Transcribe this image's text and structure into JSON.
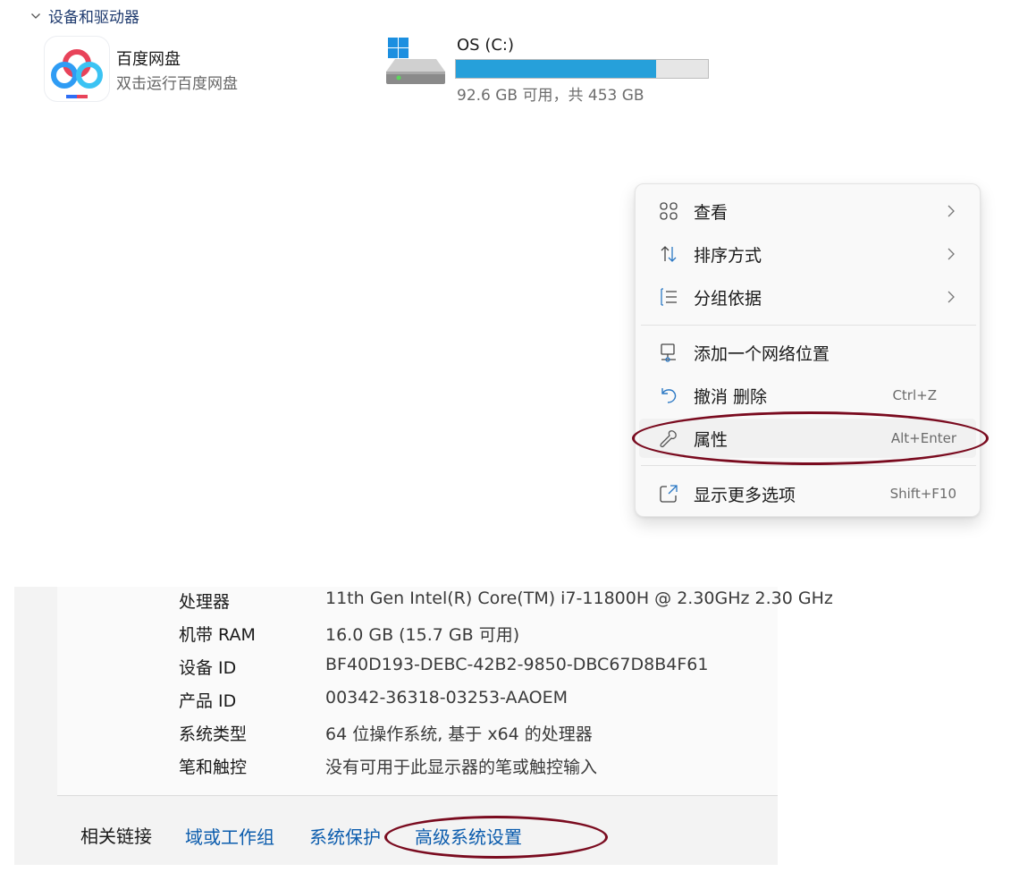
{
  "section": {
    "title": "设备和驱动器"
  },
  "app": {
    "name": "百度网盘",
    "subtitle": "双击运行百度网盘",
    "icon": "baidu-netdisk-icon"
  },
  "drive": {
    "name": "OS (C:)",
    "info": "92.6 GB 可用，共 453 GB",
    "used_fraction": 0.796,
    "icon": "drive-icon",
    "bar_color": "#26a0da"
  },
  "context_menu": {
    "items": [
      {
        "label": "查看",
        "icon": "view-grid-icon",
        "submenu": true
      },
      {
        "label": "排序方式",
        "icon": "sort-icon",
        "submenu": true
      },
      {
        "label": "分组依据",
        "icon": "group-by-icon",
        "submenu": true
      },
      {
        "label": "添加一个网络位置",
        "icon": "network-location-icon"
      },
      {
        "label": "撤消 删除",
        "icon": "undo-icon",
        "shortcut": "Ctrl+Z"
      },
      {
        "label": "属性",
        "icon": "wrench-icon",
        "shortcut": "Alt+Enter"
      },
      {
        "label": "显示更多选项",
        "icon": "more-options-icon",
        "shortcut": "Shift+F10"
      }
    ]
  },
  "system_info": {
    "rows": [
      {
        "label": "处理器",
        "value": "11th Gen Intel(R) Core(TM) i7-11800H @ 2.30GHz   2.30 GHz"
      },
      {
        "label": "机带 RAM",
        "value": "16.0 GB (15.7 GB 可用)"
      },
      {
        "label": "设备 ID",
        "value": "BF40D193-DEBC-42B2-9850-DBC67D8B4F61"
      },
      {
        "label": "产品 ID",
        "value": "00342-36318-03253-AAOEM"
      },
      {
        "label": "系统类型",
        "value": "64 位操作系统, 基于 x64 的处理器"
      },
      {
        "label": "笔和触控",
        "value": "没有可用于此显示器的笔或触控输入"
      }
    ]
  },
  "related_links": {
    "title": "相关链接",
    "links": [
      "域或工作组",
      "系统保护",
      "高级系统设置"
    ]
  },
  "colors": {
    "annotation": "#7a0b1f",
    "link": "#0b5cad"
  }
}
